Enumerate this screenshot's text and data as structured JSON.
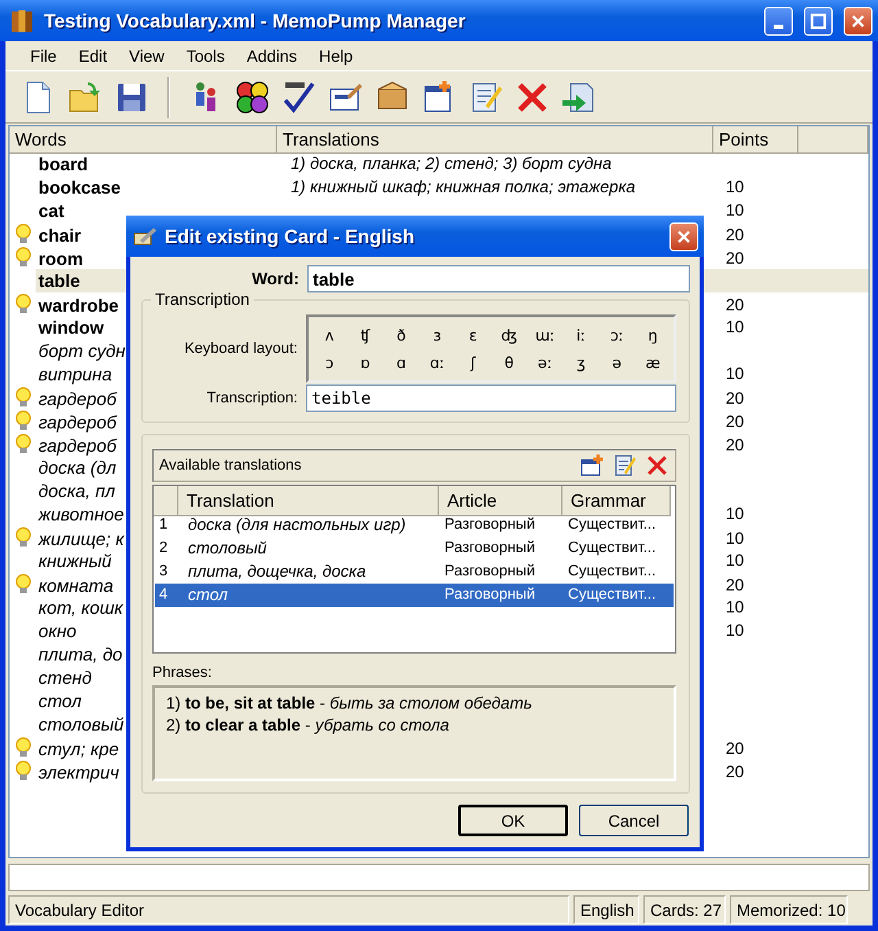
{
  "window": {
    "title": "Testing Vocabulary.xml - MemoPump Manager"
  },
  "menu": [
    "File",
    "Edit",
    "View",
    "Tools",
    "Addins",
    "Help"
  ],
  "table": {
    "columns": [
      "Words",
      "Translations",
      "Points"
    ],
    "rows": [
      {
        "word": "board",
        "kind": "english",
        "bulb": false,
        "selected": false,
        "translation": "1) доска, планка; 2) стенд; 3) борт судна"
      },
      {
        "word": "bookcase",
        "kind": "english",
        "bulb": false,
        "selected": false,
        "translation": "1) книжный шкаф; книжная полка; этажерка",
        "points": "10"
      },
      {
        "word": "cat",
        "kind": "english",
        "bulb": false,
        "selected": false,
        "points": "10"
      },
      {
        "word": "chair",
        "kind": "english",
        "bulb": true,
        "selected": false,
        "points": "20"
      },
      {
        "word": "room",
        "kind": "english",
        "bulb": true,
        "selected": false,
        "points": "20"
      },
      {
        "word": "table",
        "kind": "english",
        "bulb": false,
        "selected": true
      },
      {
        "word": "wardrobe",
        "kind": "english",
        "bulb": true,
        "selected": false,
        "points": "20"
      },
      {
        "word": "window",
        "kind": "english",
        "bulb": false,
        "selected": false,
        "points": "10"
      },
      {
        "word": "борт судн",
        "kind": "russian",
        "bulb": false,
        "selected": false
      },
      {
        "word": "витрина",
        "kind": "russian",
        "bulb": false,
        "selected": false,
        "points": "10"
      },
      {
        "word": "гардероб",
        "kind": "russian",
        "bulb": true,
        "selected": false,
        "points": "20"
      },
      {
        "word": "гардероб",
        "kind": "russian",
        "bulb": true,
        "selected": false,
        "points": "20"
      },
      {
        "word": "гардероб",
        "kind": "russian",
        "bulb": true,
        "selected": false,
        "points": "20"
      },
      {
        "word": "доска (дл",
        "kind": "russian",
        "bulb": false,
        "selected": false
      },
      {
        "word": "доска, пл",
        "kind": "russian",
        "bulb": false,
        "selected": false
      },
      {
        "word": "животное",
        "kind": "russian",
        "bulb": false,
        "selected": false,
        "points": "10"
      },
      {
        "word": "жилище; к",
        "kind": "russian",
        "bulb": true,
        "selected": false,
        "points": "10"
      },
      {
        "word": "книжный",
        "kind": "russian",
        "bulb": false,
        "selected": false,
        "points": "10"
      },
      {
        "word": "комната",
        "kind": "russian",
        "bulb": true,
        "selected": false,
        "points": "20"
      },
      {
        "word": "кот, кошк",
        "kind": "russian",
        "bulb": false,
        "selected": false,
        "points": "10"
      },
      {
        "word": "окно",
        "kind": "russian",
        "bulb": false,
        "selected": false,
        "points": "10"
      },
      {
        "word": "плита, до",
        "kind": "russian",
        "bulb": false,
        "selected": false
      },
      {
        "word": "стенд",
        "kind": "russian",
        "bulb": false,
        "selected": false
      },
      {
        "word": "стол",
        "kind": "russian",
        "bulb": false,
        "selected": false
      },
      {
        "word": "столовый",
        "kind": "russian",
        "bulb": false,
        "selected": false
      },
      {
        "word": "стул; кре",
        "kind": "russian",
        "bulb": true,
        "selected": false,
        "points": "20"
      },
      {
        "word": "электрич",
        "kind": "russian",
        "bulb": true,
        "selected": false,
        "points": "20"
      }
    ]
  },
  "dialog": {
    "title": "Edit existing Card - English",
    "word_label": "Word:",
    "word": "table",
    "transcription_group": "Transcription",
    "keyboard_label": "Keyboard layout:",
    "keys": [
      "ʌ",
      "ʧ",
      "ð",
      "ɜ",
      "ɛ",
      "ʤ",
      "ɯː",
      "iː",
      "ɔː",
      "ŋ",
      "ɔ",
      "ɒ",
      "ɑ",
      "ɑː",
      "ʃ",
      "θ",
      "əː",
      "ʒ",
      "ə",
      "æ"
    ],
    "transcription_label": "Transcription:",
    "transcription": "teible",
    "translations_title": "Available translations",
    "columns": [
      "Translation",
      "Article",
      "Grammar"
    ],
    "translations": [
      {
        "number": "1",
        "translation": "доска (для настольных игр)",
        "article": "Разговорный",
        "grammar": "Существит...",
        "selected": false
      },
      {
        "number": "2",
        "translation": "столовый",
        "article": "Разговорный",
        "grammar": "Существит...",
        "selected": false
      },
      {
        "number": "3",
        "translation": "плита, дощечка, доска",
        "article": "Разговорный",
        "grammar": "Существит...",
        "selected": false
      },
      {
        "number": "4",
        "translation": "стол",
        "article": "Разговорный",
        "grammar": "Существит...",
        "selected": true
      }
    ],
    "phrases_label": "Phrases:",
    "phrases": [
      "1) **to be, sit at table** - *быть за столом обедать*",
      "2) **to clear a table** - *убрать со стола*"
    ],
    "buttons": [
      "OK",
      "Cancel"
    ]
  },
  "status_bar": {
    "mode": "Vocabulary Editor",
    "language": "English",
    "cards": "Cards: 27",
    "memorized": "Memorized: 10"
  }
}
